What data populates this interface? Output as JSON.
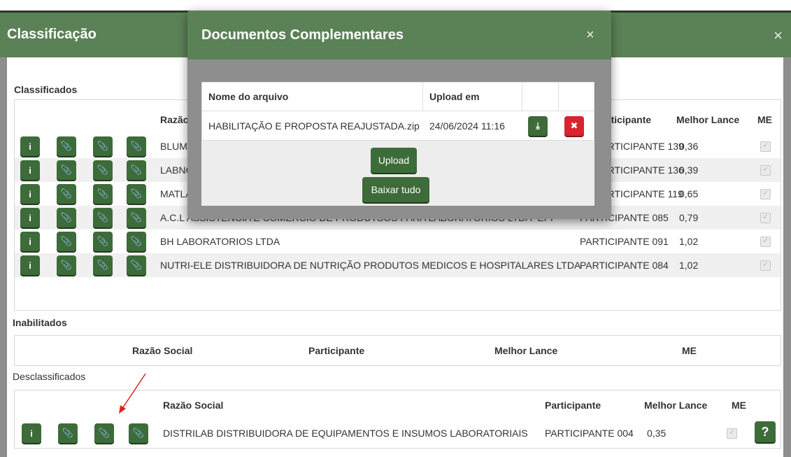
{
  "main_modal": {
    "title": "Classificação",
    "close": "×"
  },
  "sections": {
    "classificados": "Classificados",
    "inabilitados": "Inabilitados",
    "desclassificados": "Desclassificados"
  },
  "classificados_table": {
    "headers": {
      "razao": "Razão Social",
      "participante": "Participante",
      "lance": "Melhor Lance",
      "me": "ME"
    },
    "rows": [
      {
        "razao": "BLUMED PRODUTOS MEDICOS LTDA",
        "participante": "PARTICIPANTE 139",
        "lance": "0,36"
      },
      {
        "razao": "LABNORTE DISTRIBUIDORA LTDA",
        "participante": "PARTICIPANTE 136",
        "lance": "0,39"
      },
      {
        "razao": "MATLAB COMERCIO LTDA",
        "participante": "PARTICIPANTE 119",
        "lance": "0,65"
      },
      {
        "razao": "A.C.L ASSISTENCIA E COMERCIO DE PRODUTSOS PARA LABORATÓRIOS LTDA -EPP",
        "participante": "PARTICIPANTE 085",
        "lance": "0,79"
      },
      {
        "razao": "BH LABORATORIOS LTDA",
        "participante": "PARTICIPANTE 091",
        "lance": "1,02"
      },
      {
        "razao": "NUTRI-ELE DISTRIBUIDORA DE NUTRIÇÃO PRODUTOS MEDICOS E HOSPITALARES LTDA",
        "participante": "PARTICIPANTE 084",
        "lance": "1,02"
      }
    ]
  },
  "inabilitados_table": {
    "headers": {
      "razao": "Razão Social",
      "participante": "Participante",
      "lance": "Melhor Lance",
      "me": "ME"
    }
  },
  "desclassificados_table": {
    "headers": {
      "razao": "Razão Social",
      "participante": "Participante",
      "lance": "Melhor Lance",
      "me": "ME"
    },
    "rows": [
      {
        "razao": "DISTRILAB DISTRIBUIDORA DE EQUIPAMENTOS E INSUMOS LABORATORIAIS",
        "participante": "PARTICIPANTE 004",
        "lance": "0,35",
        "help": "?"
      }
    ]
  },
  "dialog": {
    "title": "Documentos Complementares",
    "close": "×",
    "headers": {
      "nome": "Nome do arquivo",
      "upload": "Upload em"
    },
    "file": {
      "nome": "HABILITAÇÃO E PROPOSTA REAJUSTADA.zip",
      "upload": "24/06/2024 11:16"
    },
    "upload_button": "Upload",
    "download_all_button": "Baixar tudo"
  },
  "icons": {
    "info": "info-icon",
    "attach": "paperclip-icon",
    "download": "download-icon",
    "delete": "delete-icon",
    "check": "✓"
  },
  "colors": {
    "header_green": "#5b8156",
    "button_green": "#3d6b39",
    "delete_red": "#d9232d",
    "annotation_arrow": "#e02020"
  }
}
